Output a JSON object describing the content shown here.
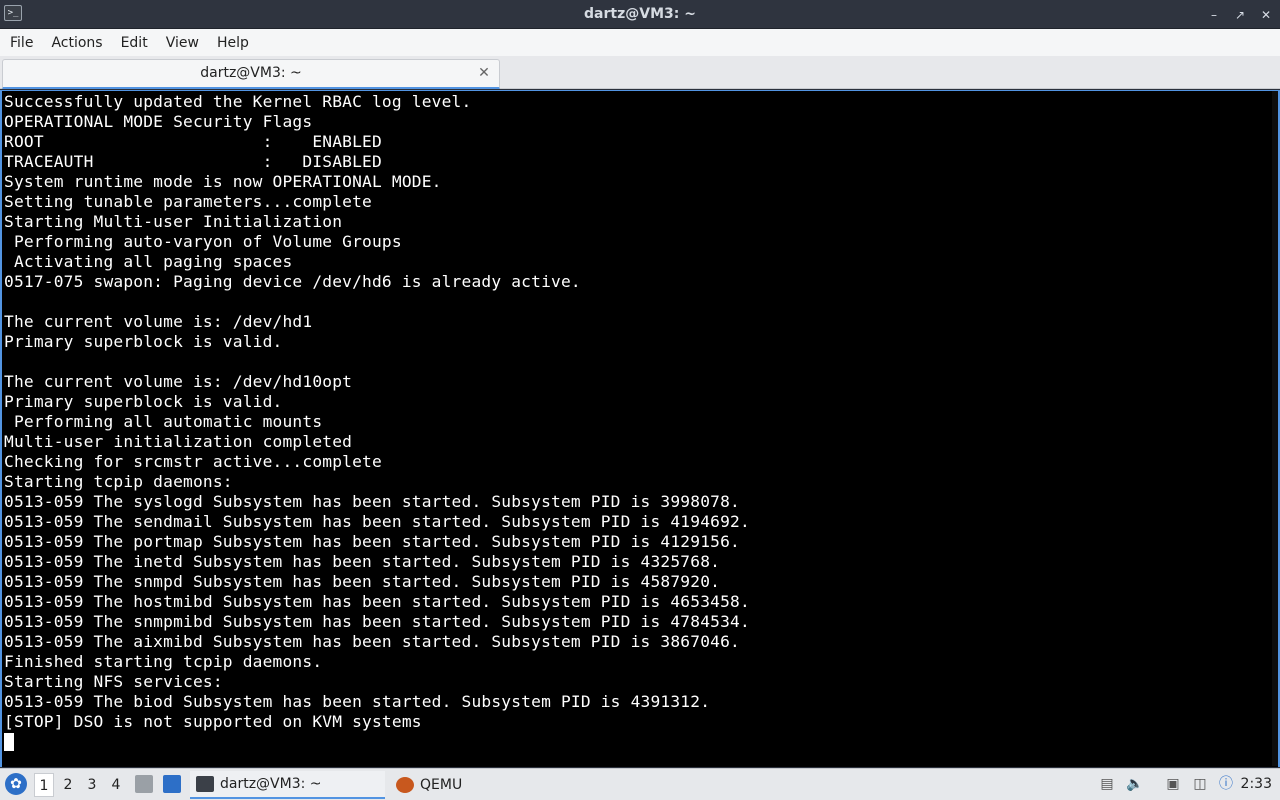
{
  "window": {
    "title": "dartz@VM3: ~",
    "app_icon_glyph": ">_"
  },
  "menubar": [
    "File",
    "Actions",
    "Edit",
    "View",
    "Help"
  ],
  "tab": {
    "label": "dartz@VM3: ~"
  },
  "terminal": {
    "lines": [
      "Successfully updated the Kernel RBAC log level.",
      "OPERATIONAL MODE Security Flags",
      "ROOT                      :    ENABLED",
      "TRACEAUTH                 :   DISABLED",
      "System runtime mode is now OPERATIONAL MODE.",
      "Setting tunable parameters...complete",
      "Starting Multi-user Initialization",
      " Performing auto-varyon of Volume Groups",
      " Activating all paging spaces",
      "0517-075 swapon: Paging device /dev/hd6 is already active.",
      "",
      "The current volume is: /dev/hd1",
      "Primary superblock is valid.",
      "",
      "The current volume is: /dev/hd10opt",
      "Primary superblock is valid.",
      " Performing all automatic mounts",
      "Multi-user initialization completed",
      "Checking for srcmstr active...complete",
      "Starting tcpip daemons:",
      "0513-059 The syslogd Subsystem has been started. Subsystem PID is 3998078.",
      "0513-059 The sendmail Subsystem has been started. Subsystem PID is 4194692.",
      "0513-059 The portmap Subsystem has been started. Subsystem PID is 4129156.",
      "0513-059 The inetd Subsystem has been started. Subsystem PID is 4325768.",
      "0513-059 The snmpd Subsystem has been started. Subsystem PID is 4587920.",
      "0513-059 The hostmibd Subsystem has been started. Subsystem PID is 4653458.",
      "0513-059 The snmpmibd Subsystem has been started. Subsystem PID is 4784534.",
      "0513-059 The aixmibd Subsystem has been started. Subsystem PID is 3867046.",
      "Finished starting tcpip daemons.",
      "Starting NFS services:",
      "0513-059 The biod Subsystem has been started. Subsystem PID is 4391312.",
      "[STOP] DSO is not supported on KVM systems"
    ]
  },
  "taskbar": {
    "workspaces": [
      "1",
      "2",
      "3",
      "4"
    ],
    "active_workspace": "1",
    "tasks": [
      {
        "label": "dartz@VM3: ~",
        "icon": "terminal-icon",
        "active": true
      },
      {
        "label": "QEMU",
        "icon": "qemu-icon",
        "active": false
      }
    ],
    "clock": "2:33",
    "colors": {
      "accent": "#5294e2",
      "start": "#2d6fc7"
    }
  }
}
